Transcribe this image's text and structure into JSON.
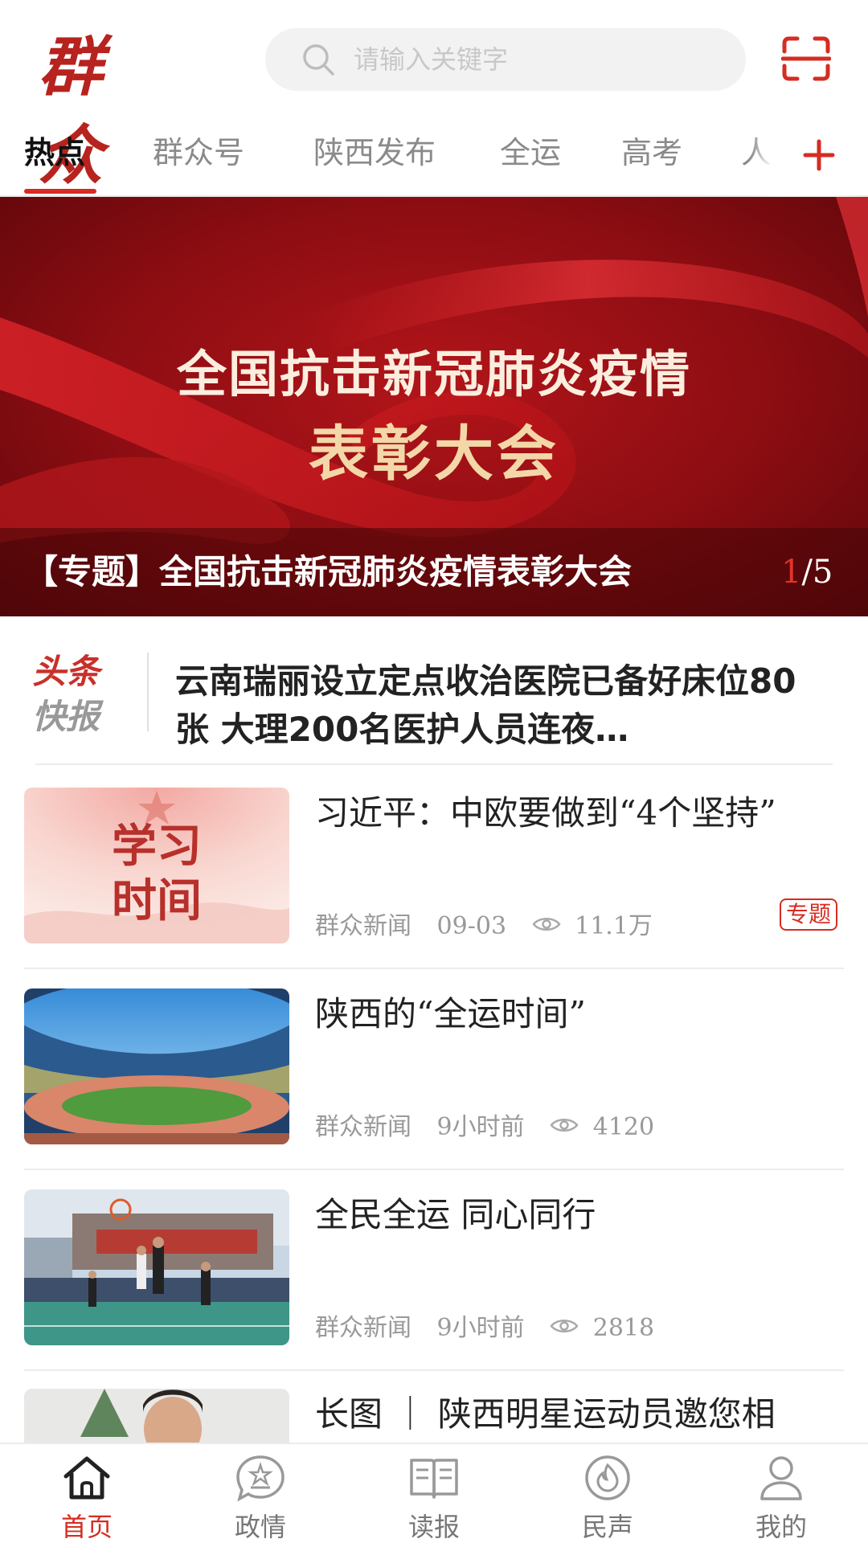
{
  "app": {
    "logo_text": "群众"
  },
  "search": {
    "placeholder": "请输入关键字"
  },
  "tabs": [
    {
      "label": "热点"
    },
    {
      "label": "群众号"
    },
    {
      "label": "陕西发布"
    },
    {
      "label": "全运"
    },
    {
      "label": "高考"
    },
    {
      "label": "人"
    }
  ],
  "banner": {
    "title_line1": "全国抗击新冠肺炎疫情",
    "title_line2": "表彰大会",
    "caption": "【专题】全国抗击新冠肺炎疫情表彰大会",
    "pager_current": "1",
    "pager_total": "/5"
  },
  "flash": {
    "logo_line1": "头条",
    "logo_line2": "快报",
    "text": "云南瑞丽设立定点收治医院已备好床位80张  大理200名医护人员连夜…"
  },
  "news": [
    {
      "thumb_text_1": "学习",
      "thumb_text_2": "时间",
      "title": "习近平：中欧要做到“4个坚持”",
      "source": "群众新闻",
      "time": "09-03",
      "views": "11.1万",
      "tag": "专题"
    },
    {
      "title": "陕西的“全运时间”",
      "source": "群众新闻",
      "time": "9小时前",
      "views": "4120"
    },
    {
      "title": "全民全运  同心同行",
      "source": "群众新闻",
      "time": "9小时前",
      "views": "2818"
    },
    {
      "title": "长图 ｜ 陕西明星运动员邀您相"
    }
  ],
  "bottom_nav": [
    {
      "label": "首页",
      "icon": "home-icon",
      "active": true
    },
    {
      "label": "政情",
      "icon": "politics-icon"
    },
    {
      "label": "读报",
      "icon": "newspaper-icon"
    },
    {
      "label": "民声",
      "icon": "voice-icon"
    },
    {
      "label": "我的",
      "icon": "profile-icon"
    }
  ],
  "colors": {
    "accent": "#d62c22",
    "banner_red": "#9b1016",
    "gold": "#f4d7a8"
  }
}
